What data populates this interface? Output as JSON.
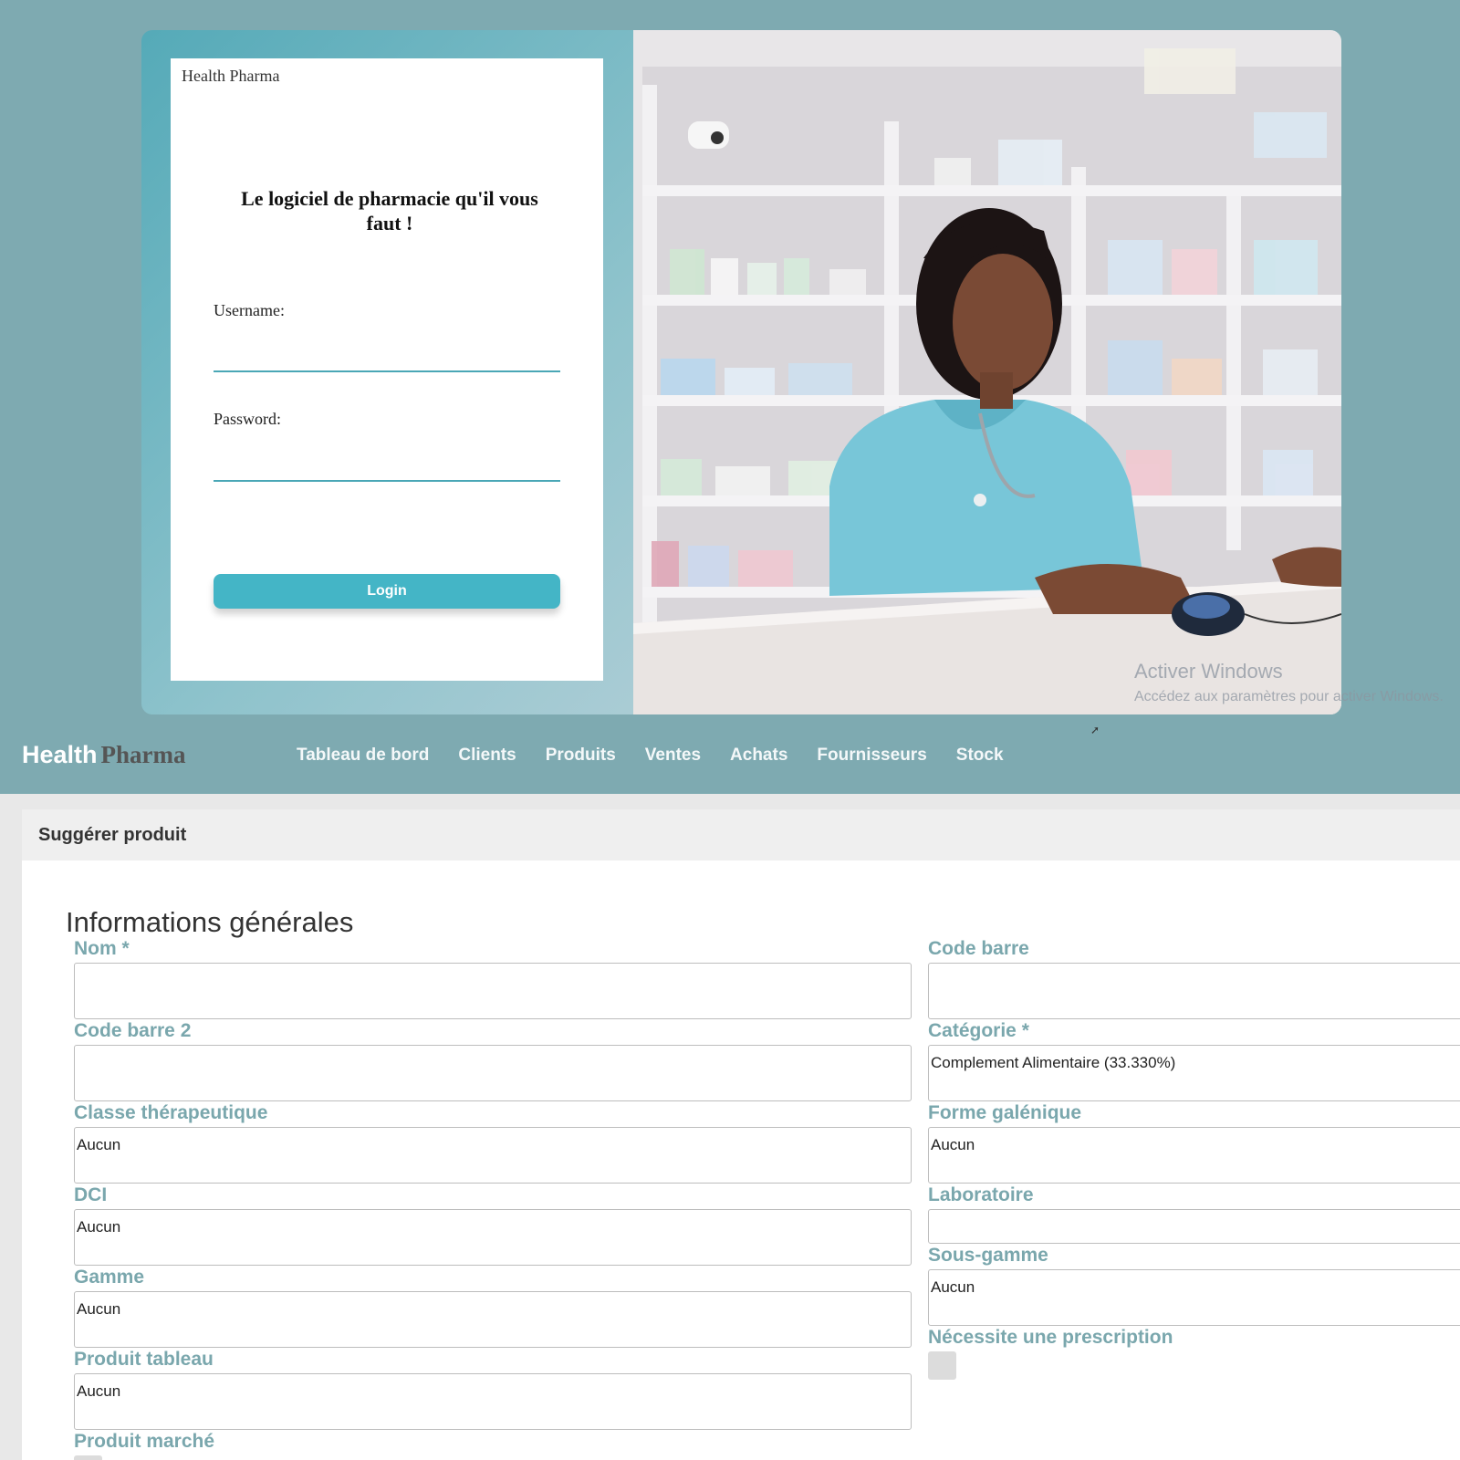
{
  "login": {
    "brand": "Health Pharma",
    "tagline": "Le logiciel de pharmacie qu'il vous faut !",
    "username_label": "Username:",
    "password_label": "Password:",
    "login_button": "Login"
  },
  "watermark": {
    "title": "Activer Windows",
    "subtitle": "Accédez aux paramètres pour activer Windows."
  },
  "nav": {
    "brand_part1": "Health",
    "brand_part2": "Pharma",
    "items": [
      "Tableau de bord",
      "Clients",
      "Produits",
      "Ventes",
      "Achats",
      "Fournisseurs",
      "Stock"
    ]
  },
  "form": {
    "header": "Suggérer produit",
    "section_title": "Informations générales",
    "left": [
      {
        "label": "Nom *",
        "value": ""
      },
      {
        "label": "Code barre 2",
        "value": ""
      },
      {
        "label": "Classe thérapeutique",
        "value": "Aucun"
      },
      {
        "label": "DCI",
        "value": "Aucun"
      },
      {
        "label": "Gamme",
        "value": "Aucun"
      },
      {
        "label": "Produit tableau",
        "value": "Aucun"
      },
      {
        "label": "Produit marché",
        "value": ""
      }
    ],
    "right": [
      {
        "label": "Code barre",
        "value": ""
      },
      {
        "label": "Catégorie *",
        "value": "Complement Alimentaire (33.330%)"
      },
      {
        "label": "Forme galénique",
        "value": "Aucun"
      },
      {
        "label": "Laboratoire",
        "value": ""
      },
      {
        "label": "Sous-gamme",
        "value": "Aucun"
      },
      {
        "label": "Nécessite une prescription",
        "value": ""
      }
    ]
  },
  "colors": {
    "background": "#7eaab1",
    "accent": "#44b5c6",
    "label": "#7aa7ad"
  }
}
